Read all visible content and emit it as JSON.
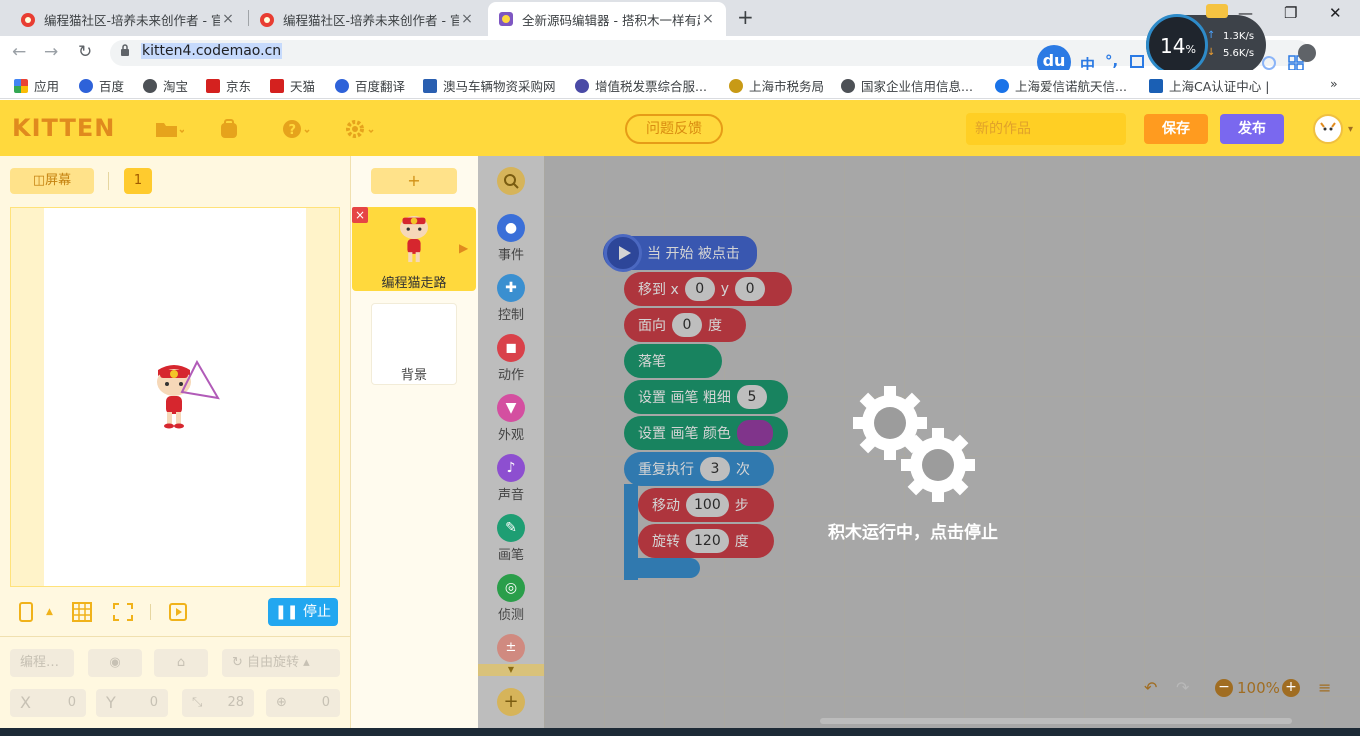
{
  "browser": {
    "tabs": [
      {
        "title": "编程猫社区-培养未来创作者 - 官",
        "close": "×"
      },
      {
        "title": "编程猫社区-培养未来创作者 - 官",
        "close": "×"
      },
      {
        "title": "全新源码编辑器 - 搭积木一样有趣",
        "close": "×"
      }
    ],
    "newtab": "+",
    "window_controls": [
      "—",
      "❐",
      "✕"
    ],
    "url": "kitten4.codemao.cn",
    "sysmon": {
      "percent": "14",
      "percent_sign": "%",
      "up": "1.3K/s",
      "down": "5.6K/s"
    },
    "ext_labels": [
      "du",
      "中",
      "°,"
    ],
    "bookmarks": [
      {
        "label": "应用"
      },
      {
        "label": "百度"
      },
      {
        "label": "淘宝"
      },
      {
        "label": "京东"
      },
      {
        "label": "天猫"
      },
      {
        "label": "百度翻译"
      },
      {
        "label": "澳马车辆物资采购网"
      },
      {
        "label": "增值税发票综合服..."
      },
      {
        "label": "上海市税务局"
      },
      {
        "label": "国家企业信用信息..."
      },
      {
        "label": "上海爱信诺航天信..."
      },
      {
        "label": "上海CA认证中心 |"
      }
    ],
    "more_bookmarks": "»"
  },
  "app": {
    "logo": "KITTEN",
    "feedback": "问题反馈",
    "work_name": "新的作品",
    "save": "保存",
    "publish": "发布"
  },
  "stage": {
    "screen_label": "屏幕",
    "page_number": "1",
    "stop_label": "停止"
  },
  "props": {
    "name": "编程…",
    "rotation_mode": "自由旋转",
    "x_label": "X",
    "x_value": "0",
    "y_label": "Y",
    "y_value": "0",
    "size_value": "28",
    "direction_value": "0"
  },
  "sprites": {
    "add": "+",
    "sprite_name": "编程猫走路",
    "background_name": "背景"
  },
  "categories": [
    {
      "label": "事件",
      "color": "#3a6fd8"
    },
    {
      "label": "控制",
      "color": "#3a8fd0"
    },
    {
      "label": "动作",
      "color": "#d9414a"
    },
    {
      "label": "外观",
      "color": "#d44fa0"
    },
    {
      "label": "声音",
      "color": "#8d4fd0"
    },
    {
      "label": "画笔",
      "color": "#1e9e73"
    },
    {
      "label": "侦测",
      "color": "#2a9e4a"
    }
  ],
  "blocks": {
    "hat": "当 开始 被点击",
    "moveto_label": "移到 x",
    "moveto_x": "0",
    "moveto_y_label": "y",
    "moveto_y": "0",
    "face_label": "面向",
    "face_value": "0",
    "face_unit": "度",
    "pendown": "落笔",
    "pensize_label": "设置 画笔 粗细",
    "pensize_value": "5",
    "pencolor_label": "设置 画笔 颜色",
    "pencolor": "#9b3fa8",
    "repeat_label": "重复执行",
    "repeat_value": "3",
    "repeat_unit": "次",
    "move_label": "移动",
    "move_value": "100",
    "move_unit": "步",
    "turn_label": "旋转",
    "turn_value": "120",
    "turn_unit": "度"
  },
  "workspace": {
    "running_message": "积木运行中，点击停止",
    "zoom": "100%"
  }
}
